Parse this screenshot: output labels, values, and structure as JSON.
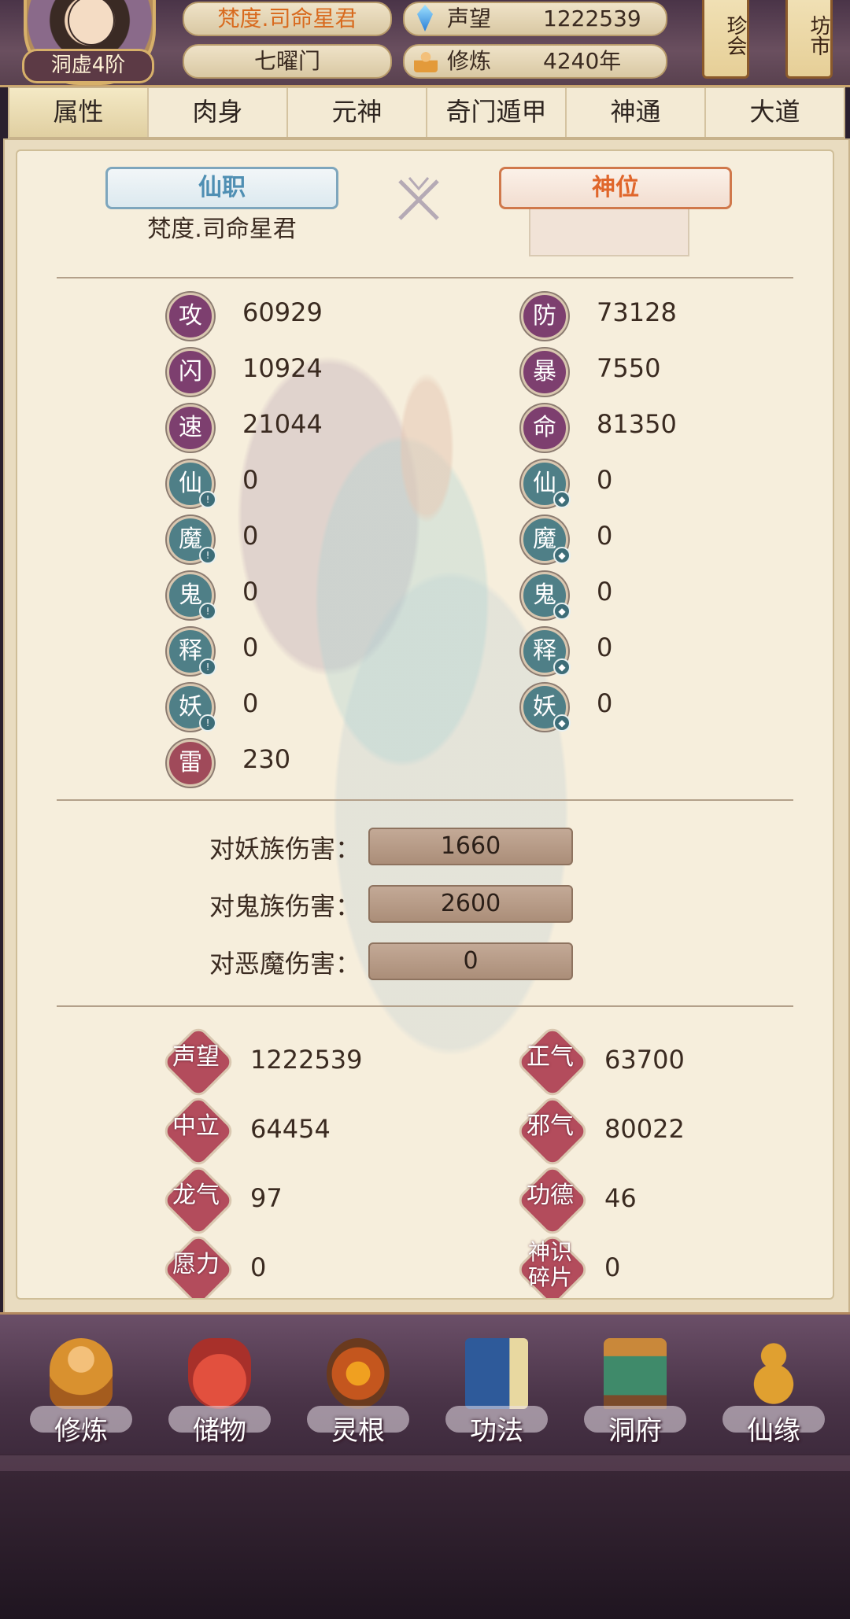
{
  "header": {
    "player_name": "梵度.司命星君",
    "sect": "七曜门",
    "realm_rank": "洞虚4阶",
    "reputation_label": "声望",
    "reputation_value": "1222539",
    "cultivation_label": "修炼",
    "cultivation_value": "4240年",
    "treasure_button": "珍会",
    "market_button": "坊市"
  },
  "tabs": [
    "属性",
    "肉身",
    "元神",
    "奇门遁甲",
    "神通",
    "大道"
  ],
  "titles": {
    "job_label": "仙职",
    "job_value": "梵度.司命星君",
    "deity_label": "神位"
  },
  "combat_stats": {
    "left": [
      {
        "label": "攻",
        "value": "60929"
      },
      {
        "label": "闪",
        "value": "10924"
      },
      {
        "label": "速",
        "value": "21044"
      },
      {
        "label": "仙",
        "value": "0"
      },
      {
        "label": "魔",
        "value": "0"
      },
      {
        "label": "鬼",
        "value": "0"
      },
      {
        "label": "释",
        "value": "0"
      },
      {
        "label": "妖",
        "value": "0"
      },
      {
        "label": "雷",
        "value": "230"
      }
    ],
    "right": [
      {
        "label": "防",
        "value": "73128"
      },
      {
        "label": "暴",
        "value": "7550"
      },
      {
        "label": "命",
        "value": "81350"
      },
      {
        "label": "仙",
        "value": "0"
      },
      {
        "label": "魔",
        "value": "0"
      },
      {
        "label": "鬼",
        "value": "0"
      },
      {
        "label": "释",
        "value": "0"
      },
      {
        "label": "妖",
        "value": "0"
      }
    ]
  },
  "damage": [
    {
      "label": "对妖族伤害：",
      "value": "1660"
    },
    {
      "label": "对鬼族伤害：",
      "value": "2600"
    },
    {
      "label": "对恶魔伤害：",
      "value": "0"
    }
  ],
  "other_stats": {
    "left": [
      {
        "label": "声望",
        "value": "1222539"
      },
      {
        "label": "中立",
        "value": "64454"
      },
      {
        "label": "龙气",
        "value": "97"
      },
      {
        "label": "愿力",
        "value": "0"
      }
    ],
    "right": [
      {
        "label": "正气",
        "value": "63700"
      },
      {
        "label": "邪气",
        "value": "80022"
      },
      {
        "label": "功德",
        "value": "46"
      },
      {
        "label": "神识碎片",
        "value": "0"
      }
    ]
  },
  "bottom_nav": [
    "修炼",
    "储物",
    "灵根",
    "功法",
    "洞府",
    "仙缘"
  ],
  "colors": {
    "accent_orange": "#d86a1e",
    "stat_purple": "#7d3f6f",
    "stat_teal": "#4f7f87",
    "stat_red": "#a04a5a"
  }
}
